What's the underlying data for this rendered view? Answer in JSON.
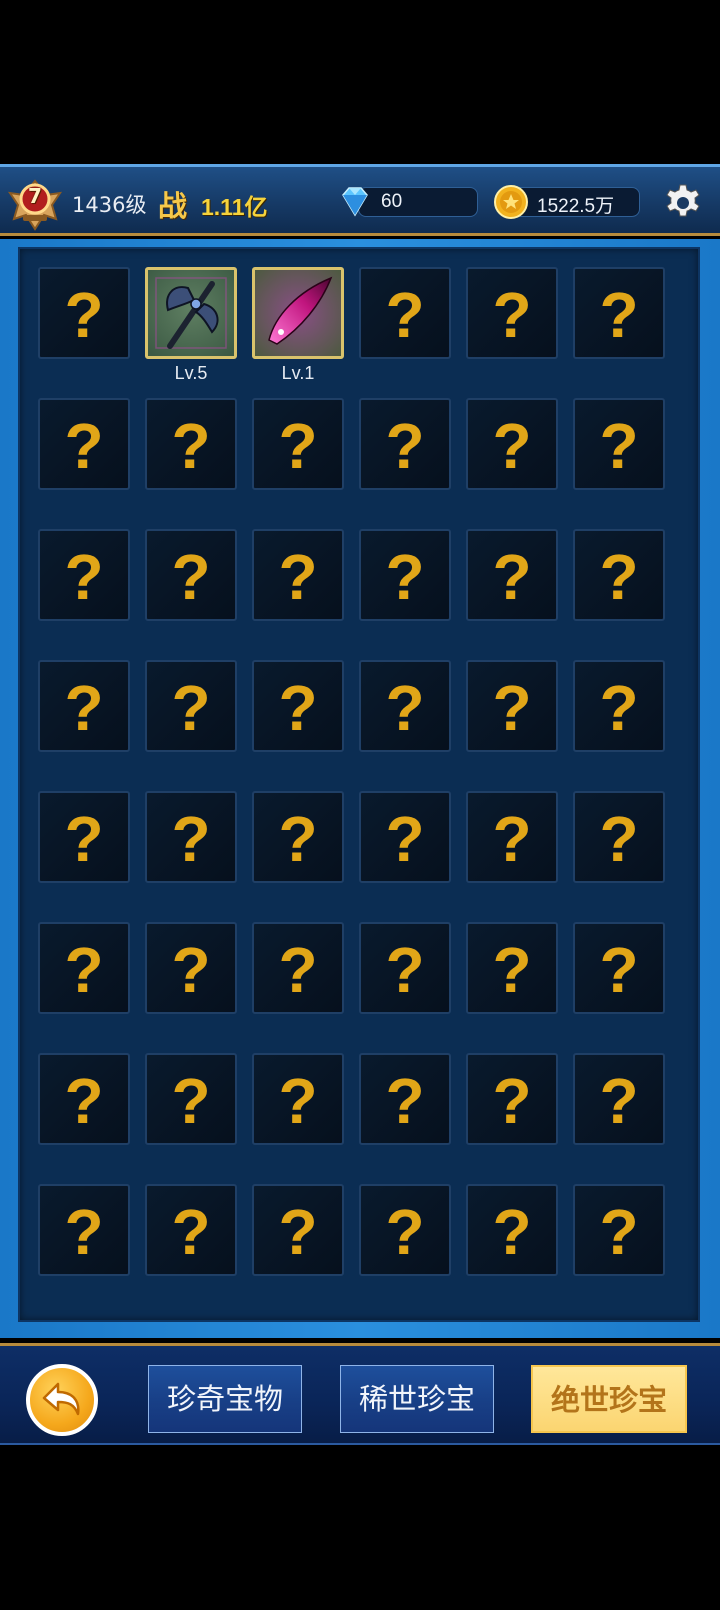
{
  "header": {
    "rank_badge": "7",
    "level": "1436级",
    "power_label": "战",
    "power_value": "1.11亿",
    "diamonds": "60",
    "gold": "1522.5万"
  },
  "grid": {
    "columns": 6,
    "rows": 8,
    "slots": [
      {
        "state": "unknown",
        "label": "?"
      },
      {
        "state": "owned",
        "item": "battle-axe-icon",
        "level": "Lv.5"
      },
      {
        "state": "owned",
        "item": "magenta-crystal-blade-icon",
        "level": "Lv.1"
      },
      {
        "state": "unknown",
        "label": "?"
      },
      {
        "state": "unknown",
        "label": "?"
      },
      {
        "state": "unknown",
        "label": "?"
      }
    ],
    "unknown_label": "?"
  },
  "bottom": {
    "tabs": [
      {
        "label": "珍奇宝物",
        "active": false
      },
      {
        "label": "稀世珍宝",
        "active": false
      },
      {
        "label": "绝世珍宝",
        "active": true
      }
    ]
  },
  "colors": {
    "gold_accent": "#e1a618",
    "panel_bg": "#0b2d53",
    "frame_blue": "#2a8fde",
    "active_tab": "#fbd571"
  }
}
